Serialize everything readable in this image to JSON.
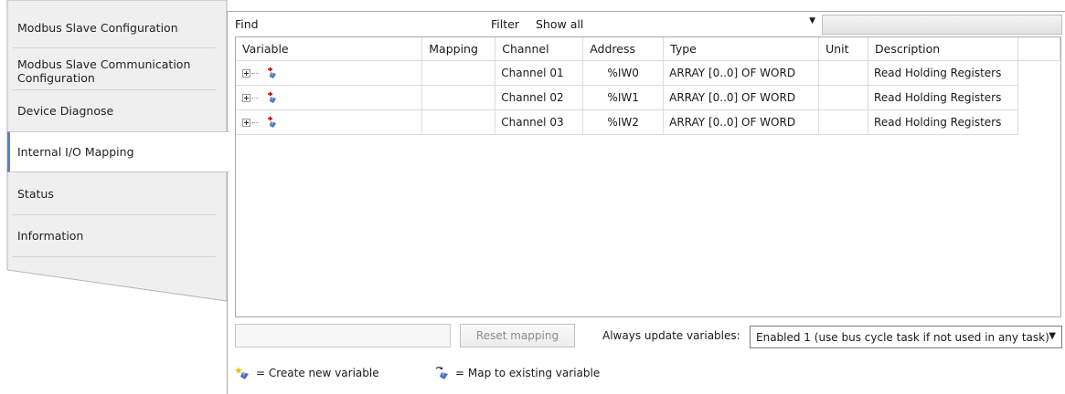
{
  "nav": {
    "items": [
      {
        "label": "Modbus Slave Configuration"
      },
      {
        "label": "Modbus Slave Communication\nConfiguration"
      },
      {
        "label": "Device Diagnose"
      },
      {
        "label": "Internal I/O Mapping"
      },
      {
        "label": "Status"
      },
      {
        "label": "Information"
      }
    ],
    "active": "Internal I/O Mapping"
  },
  "toolbar": {
    "find_label": "Find",
    "find_value": "",
    "filter_label": "Filter",
    "filter_value": "Show all"
  },
  "table": {
    "columns": [
      "Variable",
      "Mapping",
      "Channel",
      "Address",
      "Type",
      "Unit",
      "Description"
    ],
    "rows": [
      {
        "variable": "",
        "mapping": "",
        "channel": "Channel 01",
        "address": "%IW0",
        "type": "ARRAY [0..0] OF WORD",
        "unit": "",
        "description": "Read Holding Registers"
      },
      {
        "variable": "",
        "mapping": "",
        "channel": "Channel 02",
        "address": "%IW1",
        "type": "ARRAY [0..0] OF WORD",
        "unit": "",
        "description": "Read Holding Registers"
      },
      {
        "variable": "",
        "mapping": "",
        "channel": "Channel 03",
        "address": "%IW2",
        "type": "ARRAY [0..0] OF WORD",
        "unit": "",
        "description": "Read Holding Registers"
      }
    ]
  },
  "bottom": {
    "reset_label": "Reset mapping",
    "always_label": "Always update variables:",
    "always_value": "Enabled 1 (use bus cycle task if not used in any task)"
  },
  "legend": {
    "create_label": "= Create new variable",
    "map_label": "= Map to existing variable"
  },
  "colors": {
    "accent": "#4f86c6",
    "nav_bg": "#efefef",
    "border": "#a9a9a9"
  }
}
